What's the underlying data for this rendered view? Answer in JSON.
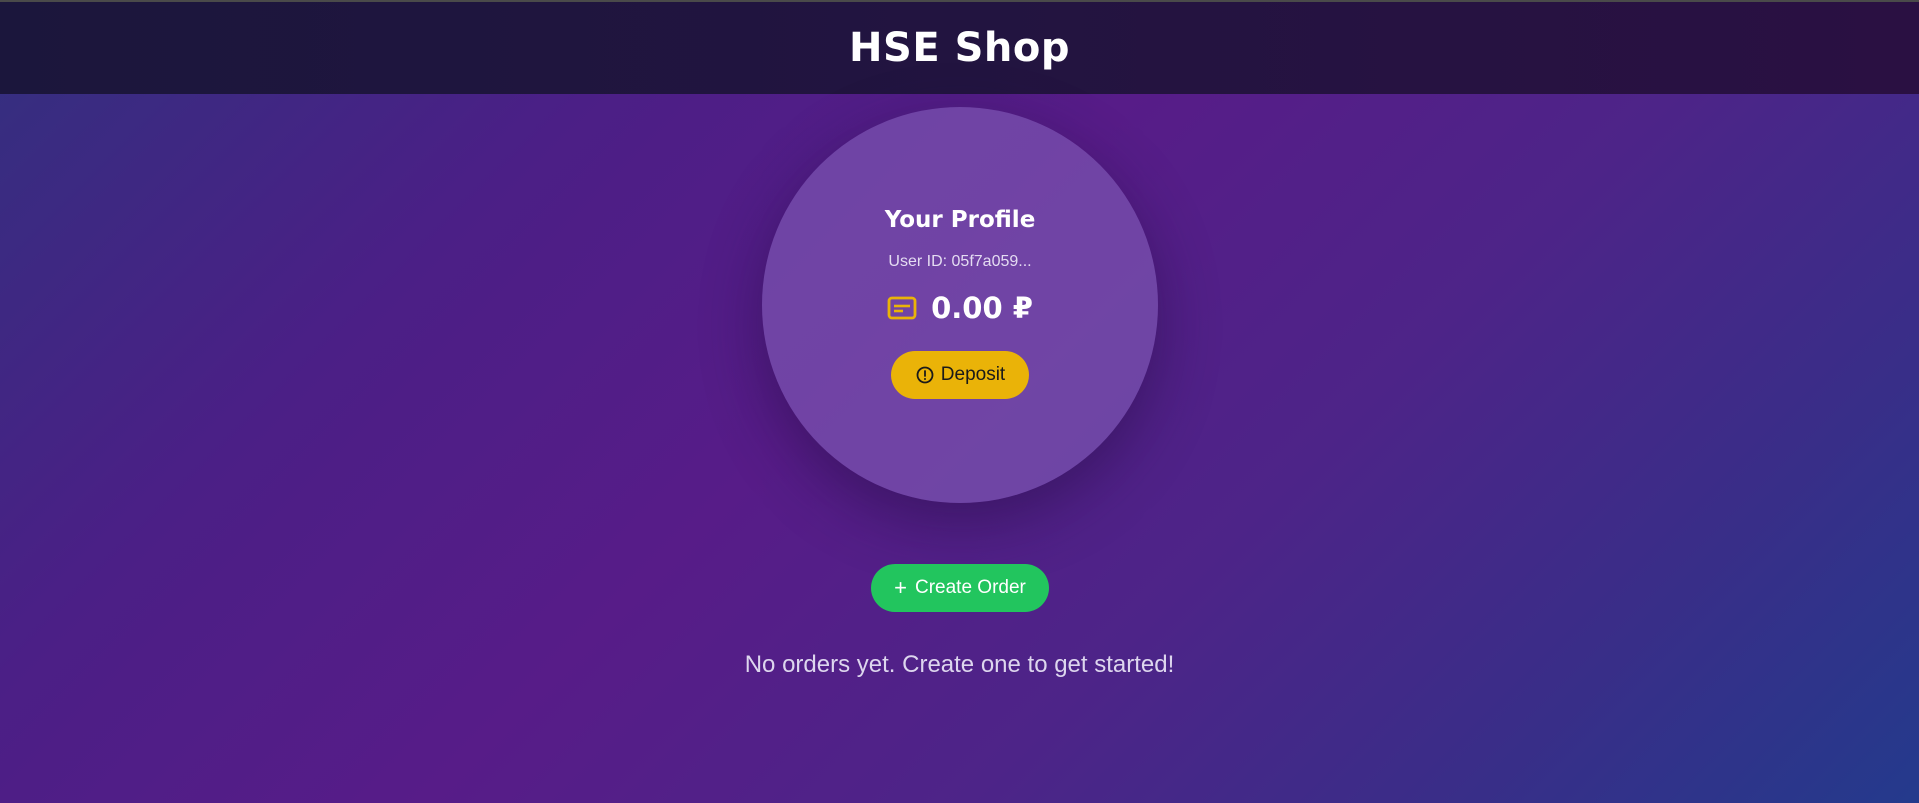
{
  "header": {
    "title": "HSE Shop"
  },
  "profile": {
    "title": "Your Profile",
    "user_id": "User ID: 05f7a059...",
    "balance": "0.00 ₽",
    "wallet_icon": "wallet-icon",
    "deposit_label": "Deposit",
    "deposit_icon": "alert-circle-icon"
  },
  "orders": {
    "create_label": "Create Order",
    "create_icon": "plus-icon",
    "empty_message": "No orders yet. Create one to get started!"
  },
  "colors": {
    "deposit_button": "#eab308",
    "create_button": "#22c55e",
    "wallet_icon": "#eab308"
  }
}
